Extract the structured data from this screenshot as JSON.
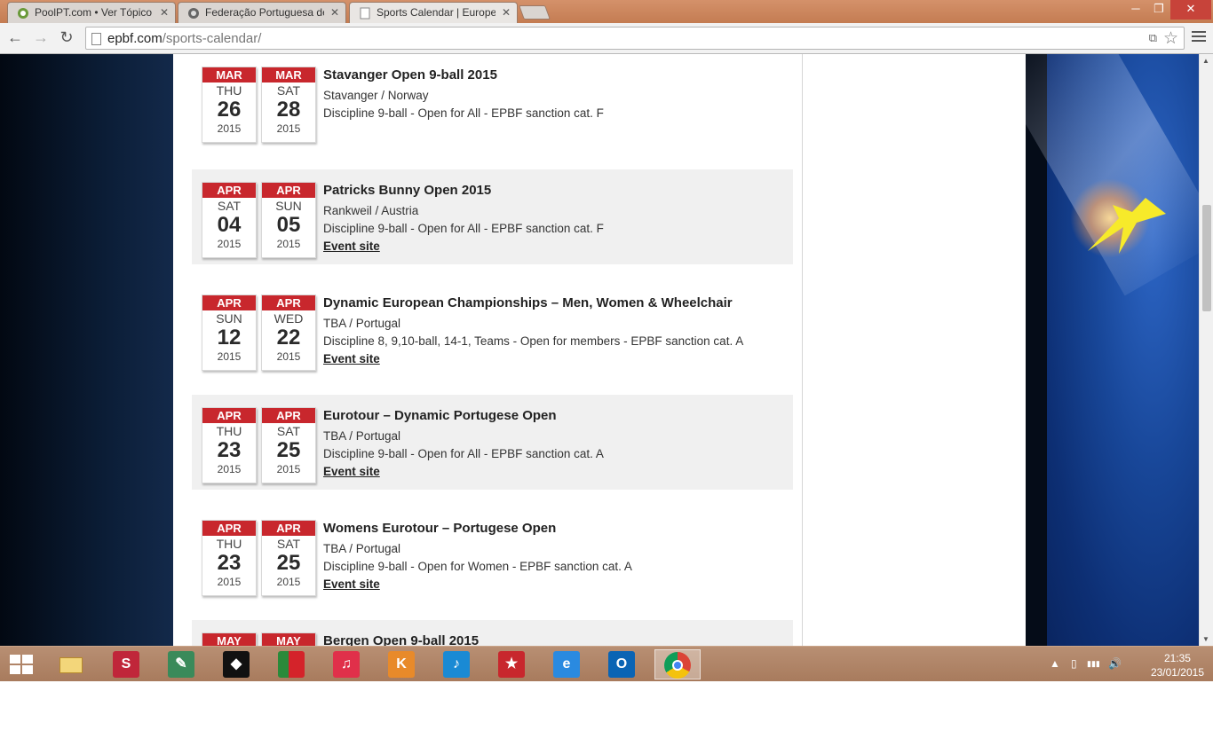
{
  "browser": {
    "tabs": [
      {
        "label": "PoolPT.com • Ver Tópico"
      },
      {
        "label": "Federação Portuguesa de"
      },
      {
        "label": "Sports Calendar | Europea"
      }
    ],
    "close_glyph": "✕",
    "url_host": "epbf.com",
    "url_path": "/sports-calendar/",
    "window_controls": {
      "minimize": "─",
      "maximize": "❐",
      "close": "✕"
    }
  },
  "events": [
    {
      "start": {
        "month": "MAR",
        "dow": "THU",
        "day": "26",
        "year": "2015"
      },
      "end": {
        "month": "MAR",
        "dow": "SAT",
        "day": "28",
        "year": "2015"
      },
      "title": "Stavanger Open 9-ball 2015",
      "location": "Stavanger / Norway",
      "discipline": "Discipline 9-ball - Open for All - EPBF sanction cat. F",
      "link": ""
    },
    {
      "start": {
        "month": "APR",
        "dow": "SAT",
        "day": "04",
        "year": "2015"
      },
      "end": {
        "month": "APR",
        "dow": "SUN",
        "day": "05",
        "year": "2015"
      },
      "title": "Patricks Bunny Open 2015",
      "location": "Rankweil / Austria",
      "discipline": "Discipline 9-ball - Open for All - EPBF sanction cat. F",
      "link": "Event site"
    },
    {
      "start": {
        "month": "APR",
        "dow": "SUN",
        "day": "12",
        "year": "2015"
      },
      "end": {
        "month": "APR",
        "dow": "WED",
        "day": "22",
        "year": "2015"
      },
      "title": "Dynamic European Championships – Men, Women & Wheelchair",
      "location": "TBA / Portugal",
      "discipline": "Discipline 8, 9,10-ball, 14-1, Teams - Open for members - EPBF sanction cat. A",
      "link": "Event site"
    },
    {
      "start": {
        "month": "APR",
        "dow": "THU",
        "day": "23",
        "year": "2015"
      },
      "end": {
        "month": "APR",
        "dow": "SAT",
        "day": "25",
        "year": "2015"
      },
      "title": "Eurotour – Dynamic Portugese Open",
      "location": "TBA / Portugal",
      "discipline": "Discipline 9-ball - Open for All - EPBF sanction cat. A",
      "link": "Event site"
    },
    {
      "start": {
        "month": "APR",
        "dow": "THU",
        "day": "23",
        "year": "2015"
      },
      "end": {
        "month": "APR",
        "dow": "SAT",
        "day": "25",
        "year": "2015"
      },
      "title": "Womens Eurotour – Portugese Open",
      "location": "TBA / Portugal",
      "discipline": "Discipline 9-ball - Open for Women - EPBF sanction cat. A",
      "link": "Event site"
    },
    {
      "start": {
        "month": "MAY",
        "dow": "",
        "day": "",
        "year": ""
      },
      "end": {
        "month": "MAY",
        "dow": "",
        "day": "",
        "year": ""
      },
      "title": "Bergen Open 9-ball 2015",
      "location": "",
      "discipline": "",
      "link": ""
    }
  ],
  "taskbar": {
    "apps": [
      {
        "name": "file-explorer-icon",
        "glyph": "",
        "color": "#e8c35a"
      },
      {
        "name": "steam-like-app-icon",
        "glyph": "S",
        "color": "#c0263a"
      },
      {
        "name": "media-app-icon",
        "glyph": "✎",
        "color": "#3a8a5a"
      },
      {
        "name": "dark-app-icon",
        "glyph": "◆",
        "color": "#111111"
      },
      {
        "name": "portugal-flag-icon",
        "glyph": "",
        "color": "#2a8a3a"
      },
      {
        "name": "itunes-icon",
        "glyph": "♫",
        "color": "#e0304a"
      },
      {
        "name": "k3-app-icon",
        "glyph": "K",
        "color": "#e88a2a"
      },
      {
        "name": "music-app-icon",
        "glyph": "♪",
        "color": "#1a8ad4"
      },
      {
        "name": "pokerstars-icon",
        "glyph": "★",
        "color": "#c8272d"
      },
      {
        "name": "internet-explorer-icon",
        "glyph": "e",
        "color": "#2a8ae0"
      },
      {
        "name": "outlook-icon",
        "glyph": "O",
        "color": "#0a64b4"
      },
      {
        "name": "chrome-icon",
        "glyph": "",
        "color": "#dddddd"
      }
    ],
    "clock_time": "21:35",
    "clock_date": "23/01/2015",
    "tray_up_arrow": "▲",
    "tray_signal": "▮▮▮",
    "tray_volume": "🔊"
  }
}
